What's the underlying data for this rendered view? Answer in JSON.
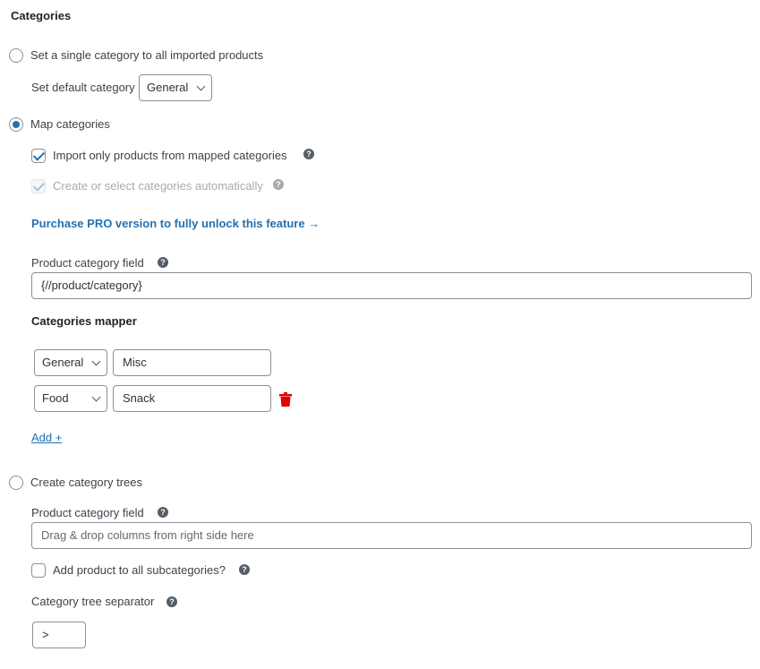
{
  "section": {
    "title": "Categories"
  },
  "options": {
    "single": {
      "label": "Set a single category to all imported products",
      "selected": false,
      "default_category_label": "Set default category",
      "default_category_value": "General"
    },
    "map": {
      "label": "Map categories",
      "selected": true,
      "import_only_mapped_label": "Import only products from mapped categories",
      "import_only_mapped_checked": true,
      "auto_create_label": "Create or select categories automatically",
      "auto_create_checked": true,
      "auto_create_disabled": true,
      "pro_link": "Purchase PRO version to fully unlock this feature →",
      "field_label": "Product category field",
      "field_value": "{//product/category}",
      "mapper_title": "Categories mapper",
      "rows": [
        {
          "category": "General",
          "value": "Misc",
          "deletable": false
        },
        {
          "category": "Food",
          "value": "Snack",
          "deletable": true
        }
      ],
      "add_link": "Add +"
    },
    "trees": {
      "label": "Create category trees",
      "selected": false,
      "field_label": "Product category field",
      "field_placeholder": "Drag & drop columns from right side here",
      "subcategories_label": "Add product to all subcategories?",
      "subcategories_checked": false,
      "separator_label": "Category tree separator",
      "separator_value": ">"
    }
  },
  "icons": {
    "help": "?",
    "trash": "trash-icon"
  },
  "colors": {
    "accent": "#2271b1",
    "delete": "#e00000"
  }
}
